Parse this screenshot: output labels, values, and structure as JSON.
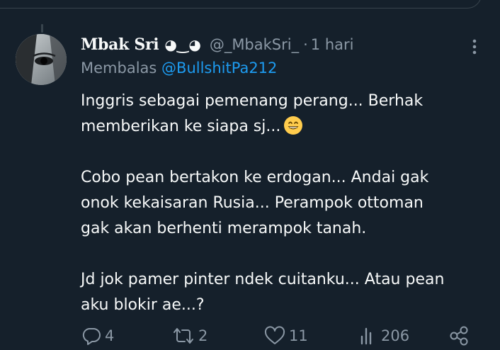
{
  "tweet": {
    "display_name": "Mbak Sri",
    "name_emoji": "◕‿◕",
    "handle": "@_MbakSri_",
    "separator": "·",
    "time": "1 hari",
    "replying_prefix": "Membalas",
    "replying_to": "@BullshitPa212",
    "paragraphs": [
      {
        "line1": "Inggris sebagai pemenang perang... Berhak",
        "line2": "memberikan ke siapa sj..."
      },
      {
        "line1": "Cobo pean bertakon ke erdogan... Andai gak",
        "line2": "onok kekaisaran Rusia... Perampok ottoman",
        "line3": "gak akan berhenti merampok tanah."
      },
      {
        "line1": "Jd jok pamer pinter ndek cuitanku... Atau pean",
        "line2": "aku blokir ae...?"
      }
    ],
    "emoji_icon": "grinning-face-emoji"
  },
  "actions": {
    "reply_count": "4",
    "retweet_count": "2",
    "like_count": "11",
    "views_count": "206"
  },
  "colors": {
    "background": "#15202b",
    "text": "#f7f9f9",
    "muted": "#8b98a5",
    "accent": "#1d9bf0",
    "border": "#38444d"
  },
  "icons": [
    "more-icon",
    "reply-icon",
    "retweet-icon",
    "like-icon",
    "views-icon",
    "share-icon"
  ]
}
